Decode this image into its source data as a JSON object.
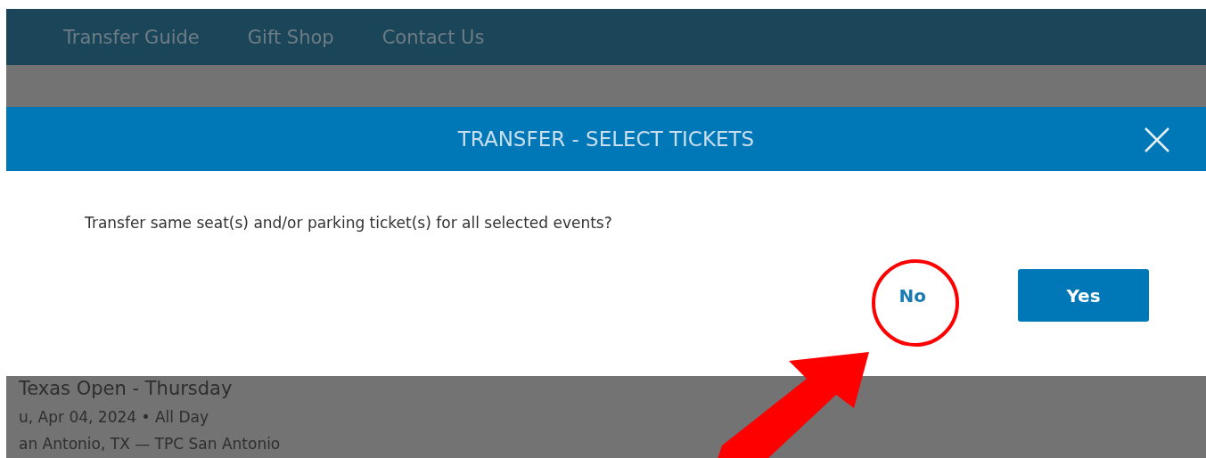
{
  "nav": {
    "items": [
      "Transfer Guide",
      "Gift Shop",
      "Contact Us"
    ]
  },
  "modal": {
    "title": "TRANSFER - SELECT TICKETS",
    "question": "Transfer same seat(s) and/or parking ticket(s) for all selected events?",
    "buttons": [
      {
        "label": "No",
        "kind": "link"
      },
      {
        "label": "Yes",
        "kind": "primary"
      }
    ]
  },
  "event": {
    "title": "Texas Open - Thursday",
    "date": "u, Apr 04, 2024 • All Day",
    "location": "an Antonio, TX — TPC San Antonio"
  },
  "annotation": {
    "circle": true,
    "arrow": true
  }
}
